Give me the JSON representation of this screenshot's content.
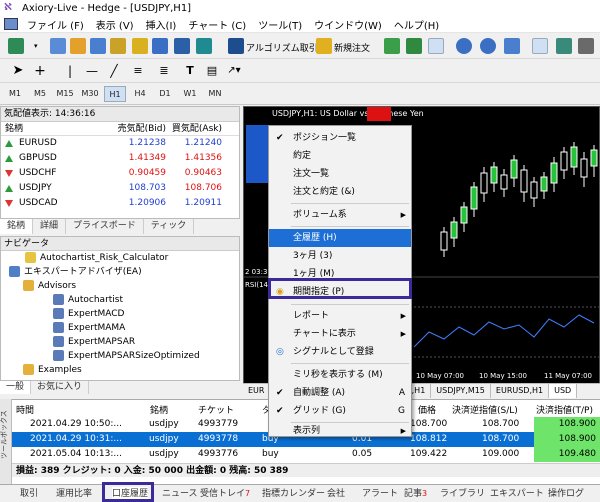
{
  "window": {
    "title": "Axiory-Live - Hedge - [USDJPY,H1]"
  },
  "menubar": {
    "items": [
      "ファイル (F)",
      "表示 (V)",
      "挿入(I)",
      "チャート (C)",
      "ツール(T)",
      "ウインドウ(W)",
      "ヘルプ(H)"
    ]
  },
  "toolbar": {
    "algo_label": "アルゴリズム取引",
    "new_order_label": "新規注文"
  },
  "timeframes": [
    "M1",
    "M5",
    "M15",
    "M30",
    "H1",
    "H4",
    "D1",
    "W1",
    "MN"
  ],
  "timeframe_selected": "H1",
  "market_watch": {
    "header": "気配値表示: 14:36:16",
    "col_symbol": "銘柄",
    "col_bid": "売気配(Bid)",
    "col_ask": "買気配(Ask)",
    "rows": [
      {
        "symbol": "EURUSD",
        "bid": "1.21238",
        "ask": "1.21240",
        "dir": "up",
        "color": "blue"
      },
      {
        "symbol": "GBPUSD",
        "bid": "1.41349",
        "ask": "1.41356",
        "dir": "up",
        "color": "red"
      },
      {
        "symbol": "USDCHF",
        "bid": "0.90459",
        "ask": "0.90463",
        "dir": "dn",
        "color": "red"
      },
      {
        "symbol": "USDJPY",
        "bid": "108.703",
        "ask": "108.706",
        "dir": "up",
        "color": "blue"
      },
      {
        "symbol": "USDCAD",
        "bid": "1.20906",
        "ask": "1.20911",
        "dir": "dn",
        "color": "blue"
      }
    ],
    "tabs": [
      "銘柄",
      "詳細",
      "プライスボード",
      "ティック"
    ]
  },
  "navigator": {
    "header": "ナビゲータ",
    "items": [
      "Autochartist_Risk_Calculator",
      "エキスパートアドバイザ(EA)",
      "Advisors",
      "Autochartist",
      "ExpertMACD",
      "ExpertMAMA",
      "ExpertMAPSAR",
      "ExpertMAPSARSizeOptimized",
      "Examples"
    ],
    "tabs": [
      "一般",
      "お気に入り"
    ]
  },
  "chart": {
    "title": "USDJPY,H1: US Dollar vs Japanese Yen",
    "time_label_1": "2 03:3",
    "rsi_label": "RSI(14",
    "time_label_2": "10 May 07:00",
    "time_label_3": "10 May 15:00",
    "time_label_4": "11 May 07:00",
    "tabs": [
      "EUR",
      "D,H1",
      "USDJPY,M15",
      "EURUSD,H1",
      "USD"
    ],
    "colors": {
      "bull": "#ffffff",
      "bear": "#000000",
      "up_candle_fill": "#27c33a",
      "rsi_line": "#3f7fff"
    }
  },
  "context_menu": {
    "items": [
      {
        "label": "ポジション一覧",
        "check": true
      },
      {
        "label": "約定"
      },
      {
        "label": "注文一覧"
      },
      {
        "label": "注文と約定 (&)"
      },
      {
        "label": "ボリューム系",
        "submenu": true
      },
      {
        "label": "全履歴 (H)",
        "highlight": true
      },
      {
        "label": "3ヶ月 (3)"
      },
      {
        "label": "1ヶ月 (M)"
      },
      {
        "label": "期間指定 (P)"
      },
      {
        "label": "レポート",
        "submenu": true
      },
      {
        "label": "チャートに表示",
        "submenu": true
      },
      {
        "label": "シグナルとして登録"
      },
      {
        "label": "ミリ秒を表示する (M)"
      },
      {
        "label": "自動調整 (A)",
        "check": true,
        "shortcut": "A"
      },
      {
        "label": "グリッド (G)",
        "check": true,
        "shortcut": "G"
      },
      {
        "label": "表示列",
        "submenu": true
      }
    ]
  },
  "terminal": {
    "side_label": "ツールボックス",
    "headers": {
      "time": "時間",
      "symbol": "銘柄",
      "ticket": "チケット",
      "type": "タ",
      "price": "価格",
      "sl": "決済逆指値(S/L)",
      "tp": "決済指値(T/P)"
    },
    "rows": [
      {
        "time": "2021.04.29 10:50:...",
        "symbol": "usdjpy",
        "ticket": "4993779",
        "type": "",
        "volume": "",
        "price": "108.700",
        "sl": "108.700",
        "tp": "108.900"
      },
      {
        "time": "2021.04.29 10:31:...",
        "symbol": "usdjpy",
        "ticket": "4993778",
        "type": "buy",
        "volume": "0.01",
        "price": "108.812",
        "sl": "108.700",
        "tp": "108.900"
      },
      {
        "time": "2021.05.04 10:13:...",
        "symbol": "usdjpy",
        "ticket": "4993776",
        "type": "buy",
        "volume": "0.05",
        "price": "109.422",
        "sl": "109.000",
        "tp": "109.480"
      }
    ],
    "summary": "損益: 389  クレジット: 0  入金: 50 000  出金額: 0  残高: 50 389"
  },
  "bottom_tabs": [
    {
      "label": "取引"
    },
    {
      "label": "運用比率"
    },
    {
      "label": "口座履歴"
    },
    {
      "label": "ニュース"
    },
    {
      "label": "受信トレイ",
      "badge": "7"
    },
    {
      "label": "指標カレンダー"
    },
    {
      "label": "会社"
    },
    {
      "label": "アラート"
    },
    {
      "label": "記事",
      "badge": "3"
    },
    {
      "label": "ライブラリ"
    },
    {
      "label": "エキスパート"
    },
    {
      "label": "操作ログ"
    }
  ]
}
